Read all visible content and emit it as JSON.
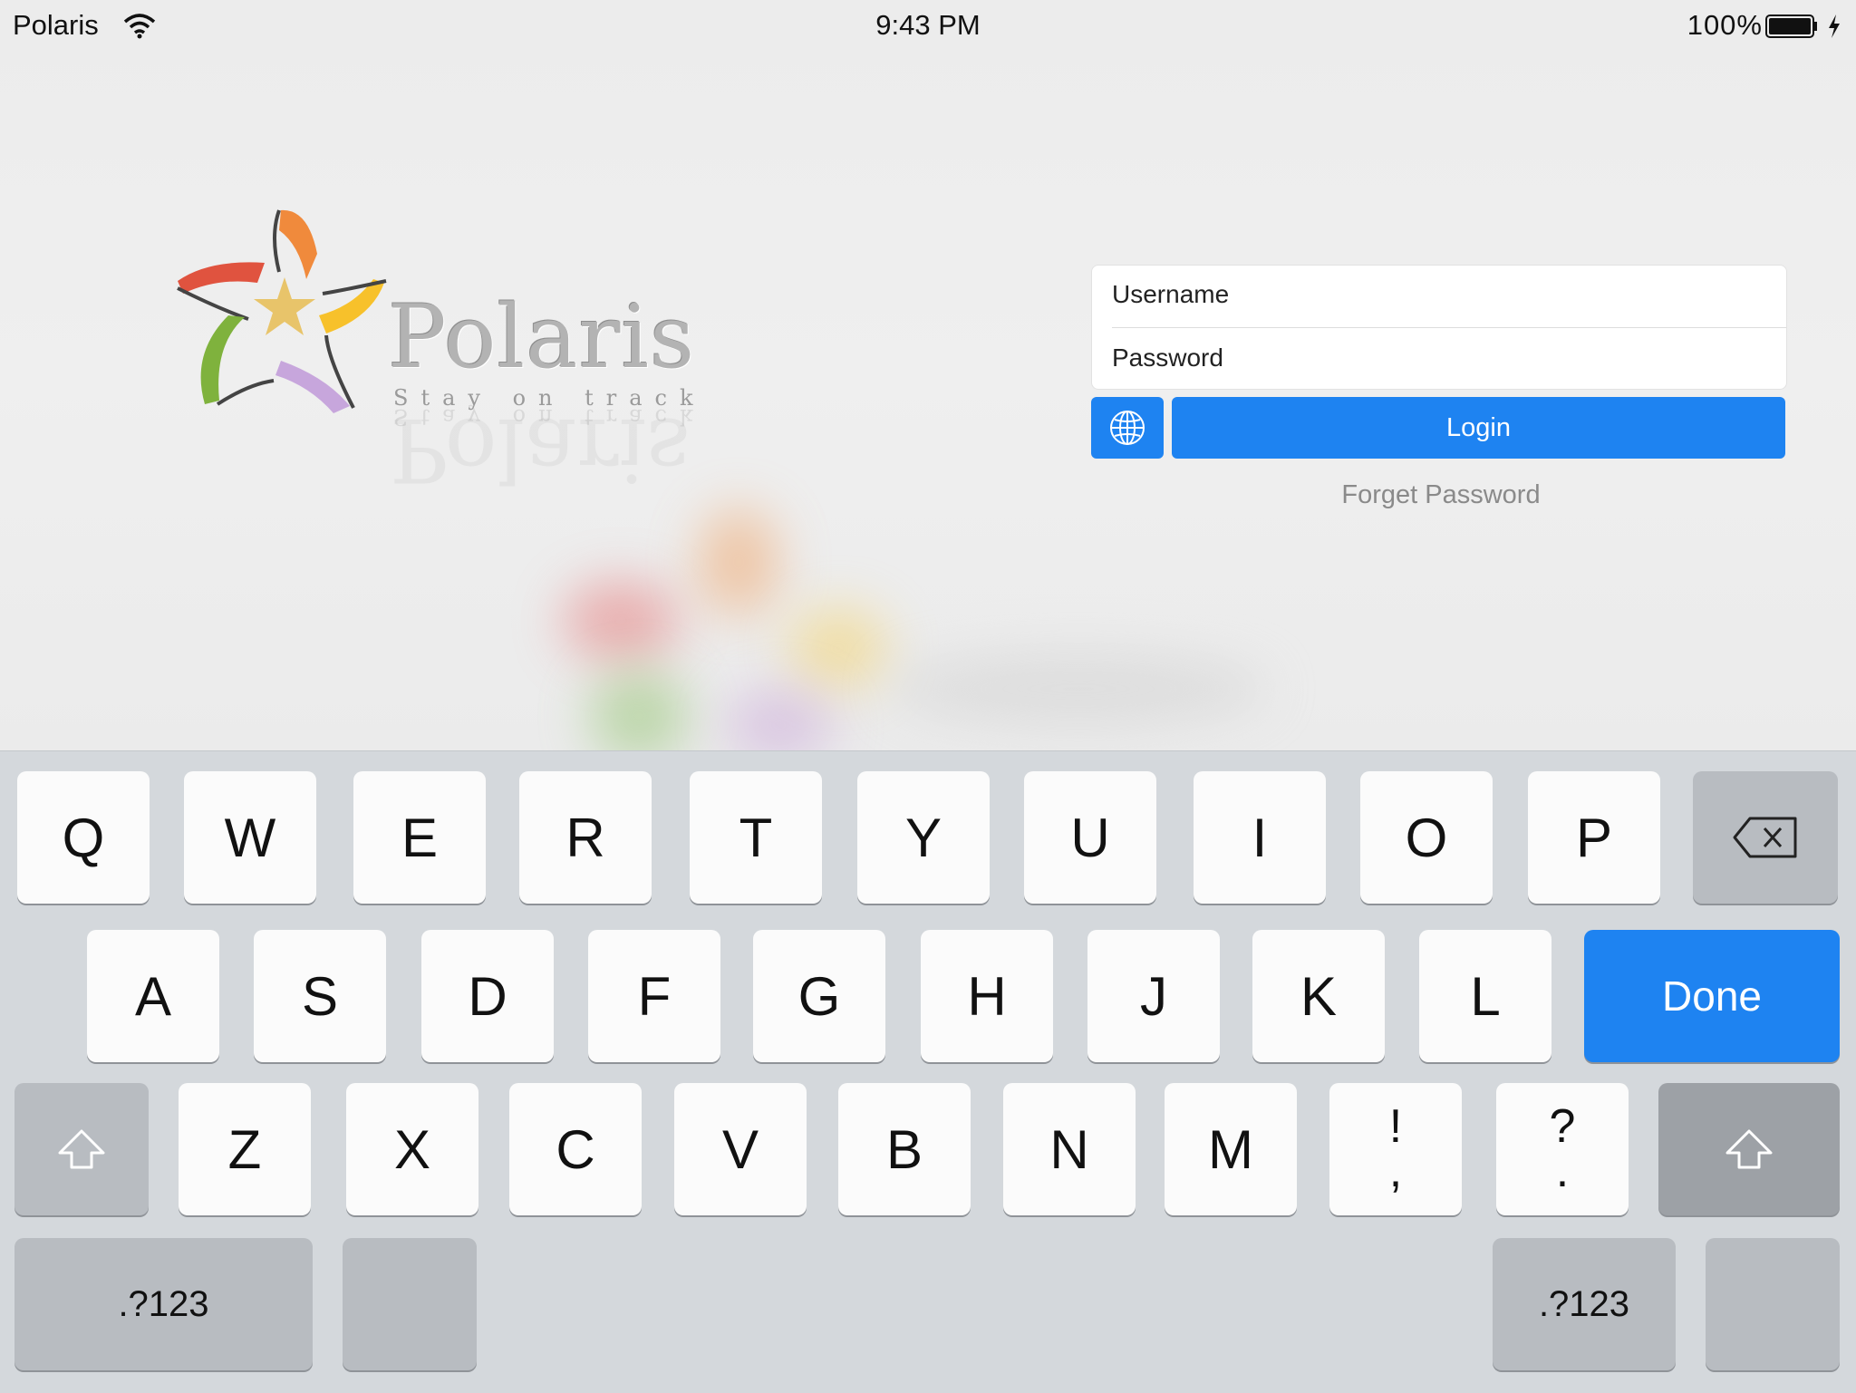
{
  "status_bar": {
    "carrier": "Polaris",
    "time": "9:43 PM",
    "battery_percent": "100%",
    "icons": [
      "wifi-icon",
      "battery-icon",
      "charging-bolt-icon"
    ]
  },
  "logo": {
    "wordmark": "Polaris",
    "tagline": "Stay on track",
    "colors": [
      "#e74c3c",
      "#f39c12",
      "#f1c40f",
      "#8e44ad",
      "#6ab04c"
    ]
  },
  "login_form": {
    "username_placeholder": "Username",
    "password_placeholder": "Password",
    "language_icon": "globe-icon",
    "login_label": "Login",
    "forget_password_label": "Forget Password"
  },
  "keyboard": {
    "row1": [
      "Q",
      "W",
      "E",
      "R",
      "T",
      "Y",
      "U",
      "I",
      "O",
      "P"
    ],
    "backspace_icon": "backspace-icon",
    "row2": [
      "A",
      "S",
      "D",
      "F",
      "G",
      "H",
      "J",
      "K",
      "L"
    ],
    "done_label": "Done",
    "shift_icon": "shift-icon",
    "row3": [
      "Z",
      "X",
      "C",
      "V",
      "B",
      "N",
      "M"
    ],
    "punct1": {
      "top": "!",
      "bottom": ","
    },
    "punct2": {
      "top": "?",
      "bottom": "."
    },
    "numbers_label": ".?123",
    "accent_color": "#1e83f1"
  }
}
